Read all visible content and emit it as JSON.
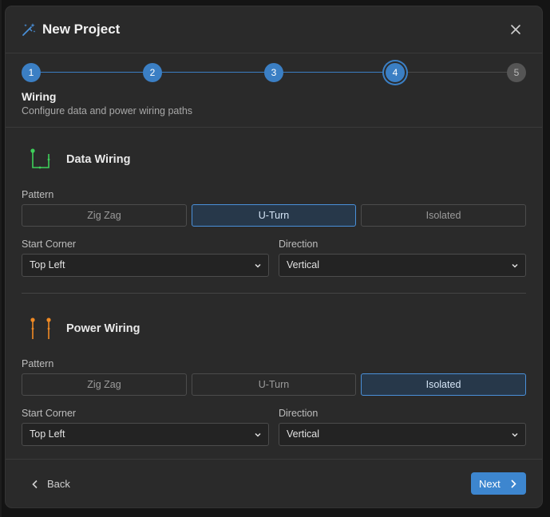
{
  "dialog": {
    "title": "New Project",
    "icon": "magic-wand-icon",
    "close_icon": "close-icon"
  },
  "stepper": {
    "steps": [
      {
        "label": "1",
        "state": "done"
      },
      {
        "label": "2",
        "state": "done"
      },
      {
        "label": "3",
        "state": "done"
      },
      {
        "label": "4",
        "state": "current"
      },
      {
        "label": "5",
        "state": "future"
      }
    ],
    "current_title": "Wiring",
    "current_subtitle": "Configure data and power wiring paths"
  },
  "data_wiring": {
    "title": "Data Wiring",
    "icon": "data-wiring-icon",
    "icon_color": "#3ecf5a",
    "pattern_label": "Pattern",
    "patterns": [
      "Zig Zag",
      "U-Turn",
      "Isolated"
    ],
    "selected_pattern": "U-Turn",
    "start_corner_label": "Start Corner",
    "start_corner_value": "Top Left",
    "direction_label": "Direction",
    "direction_value": "Vertical"
  },
  "power_wiring": {
    "title": "Power Wiring",
    "icon": "power-wiring-icon",
    "icon_color": "#f08a24",
    "pattern_label": "Pattern",
    "patterns": [
      "Zig Zag",
      "U-Turn",
      "Isolated"
    ],
    "selected_pattern": "Isolated",
    "start_corner_label": "Start Corner",
    "start_corner_value": "Top Left",
    "direction_label": "Direction",
    "direction_value": "Vertical"
  },
  "footer": {
    "back_label": "Back",
    "next_label": "Next"
  },
  "colors": {
    "accent": "#3b7fc4",
    "background": "#2a2a2a"
  }
}
